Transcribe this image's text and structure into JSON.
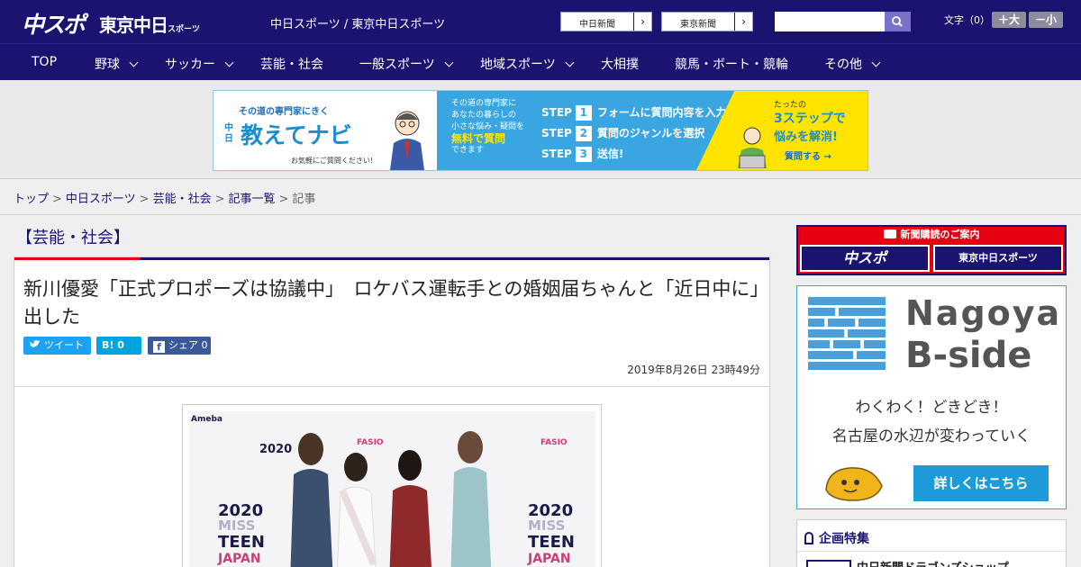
{
  "header": {
    "logo_chuspo": "中スポ",
    "logo_tokyo": "東京中日",
    "logo_tokyo_small": "スポーツ",
    "site_title": "中日スポーツ / 東京中日スポーツ",
    "btn_chunichi": "中日新聞",
    "btn_tokyo": "東京新聞",
    "btn_arrow": "›",
    "search_placeholder": "",
    "font_label": "文字（0）",
    "font_plus": "＋大",
    "font_minus": "－小"
  },
  "nav": {
    "items": [
      {
        "label": "TOP"
      },
      {
        "label": "野球"
      },
      {
        "label": "サッカー"
      },
      {
        "label": "芸能・社会"
      },
      {
        "label": "一般スポーツ"
      },
      {
        "label": "地域スポーツ"
      },
      {
        "label": "大相撲"
      },
      {
        "label": "競馬・ボート・競輪"
      },
      {
        "label": "その他"
      }
    ]
  },
  "ad": {
    "tag": "その道の専門家にきく",
    "name": "教えてナビ",
    "name_prefix": "中日",
    "ask": "お気軽にご質問ください!",
    "para1": "その道の専門家に",
    "para2": "あなたの暮らしの",
    "para3": "小さな悩み・疑問を",
    "para4": "無料で質問",
    "para5": "できます",
    "step_word": "STEP",
    "step1": "フォームに質問内容を入力",
    "step2": "質問のジャンルを選択",
    "step3": "送信!",
    "r1": "たったの",
    "r2": "3ステップで",
    "r3": "悩みを解消!",
    "r4": "質問する →"
  },
  "breadcrumb": {
    "items": [
      "トップ",
      "中日スポーツ",
      "芸能・社会",
      "記事一覧"
    ],
    "current": "記事",
    "sep": ">"
  },
  "article": {
    "category": "【芸能・社会】",
    "headline": "新川優愛「正式プロポーズは協議中」　ロケバス運転手との婚姻届ちゃんと「近日中に」出した",
    "share_tweet": "ツイート",
    "share_hatena": "B! 0",
    "share_fb": "シェア 0",
    "date": "2019年8月26日 23時49分",
    "backdrop_texts": [
      "2020",
      "MISS",
      "TEEN",
      "JAPAN",
      "Ameba",
      "FASIO"
    ]
  },
  "sidebar": {
    "promo_caption": "新聞購読のご案内",
    "promo_chuspo": "中スポ",
    "promo_tokyo": "東京中日スポーツ",
    "ad_nagoya": "Nagoya",
    "ad_bside": "B-side",
    "ad_line1": "わくわく！どきどき！",
    "ad_line2": "名古屋の水辺が変わっていく",
    "ad_cta": "詳しくはこちら",
    "feature_title": "企画特集",
    "feature_item": "中日新聞ドラゴンズショップ"
  },
  "colors": {
    "header_bg": "#1a1470",
    "accent_red": "#e60012",
    "link": "#1a1470",
    "twitter": "#1da1f2",
    "hatena": "#00a4de",
    "facebook": "#3b5998"
  }
}
